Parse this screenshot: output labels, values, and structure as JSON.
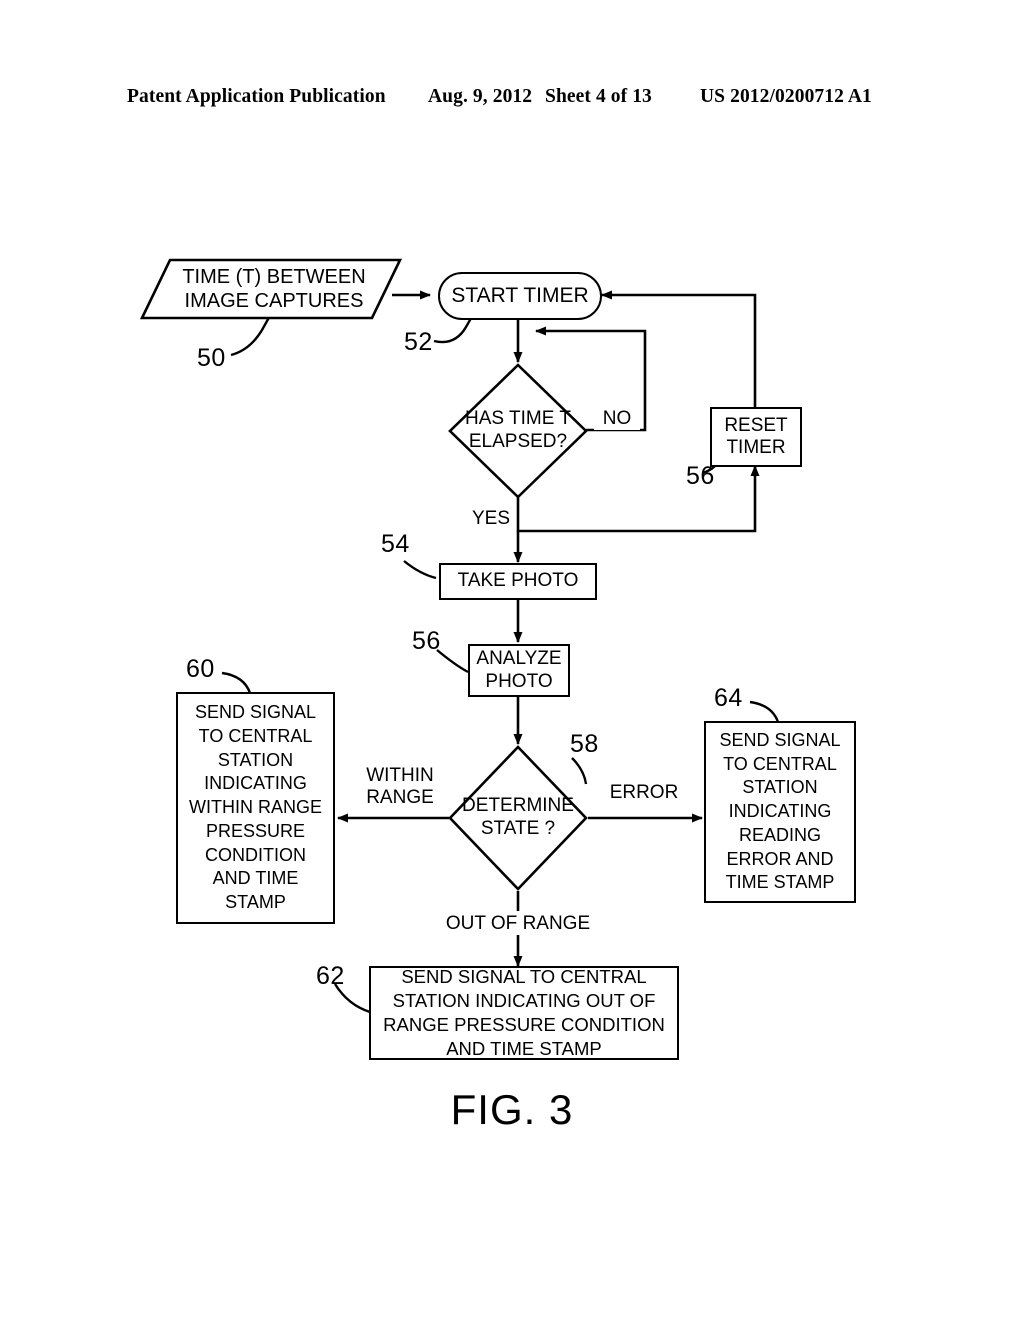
{
  "header": {
    "left": "Patent Application Publication",
    "date": "Aug. 9, 2012",
    "sheet": "Sheet 4 of 13",
    "number": "US 2012/0200712 A1"
  },
  "figure": {
    "caption": "FIG. 3",
    "type": "flowchart",
    "nodes": {
      "input_time": {
        "ref": "50",
        "shape": "parallelogram",
        "text": "TIME (T) BETWEEN\nIMAGE CAPTURES"
      },
      "start_timer": {
        "ref": "52",
        "shape": "terminator",
        "text": "START TIMER"
      },
      "has_time_elapsed": {
        "shape": "diamond",
        "text": "HAS TIME T\nELAPSED?"
      },
      "reset_timer": {
        "ref": "56",
        "shape": "process",
        "text": "RESET\nTIMER"
      },
      "take_photo": {
        "ref": "54",
        "shape": "process",
        "text": "TAKE PHOTO"
      },
      "analyze_photo": {
        "ref": "56",
        "shape": "process",
        "text": "ANALYZE\nPHOTO"
      },
      "determine_state": {
        "ref": "58",
        "shape": "diamond",
        "text": "DETERMINE\nSTATE ?"
      },
      "within_range_action": {
        "ref": "60",
        "shape": "process",
        "text": "SEND SIGNAL\nTO CENTRAL\nSTATION\nINDICATING\nWITHIN RANGE\nPRESSURE\nCONDITION\nAND TIME\nSTAMP"
      },
      "out_of_range_action": {
        "ref": "62",
        "shape": "process",
        "text": "SEND SIGNAL TO CENTRAL\nSTATION INDICATING OUT OF\nRANGE PRESSURE CONDITION\nAND TIME STAMP"
      },
      "error_action": {
        "ref": "64",
        "shape": "process",
        "text": "SEND SIGNAL\nTO CENTRAL\nSTATION\nINDICATING\nREADING\nERROR AND\nTIME STAMP"
      }
    },
    "edge_labels": {
      "no": "NO",
      "yes": "YES",
      "within_range": "WITHIN\nRANGE",
      "error": "ERROR",
      "out_of_range": "OUT OF RANGE"
    }
  },
  "colors": {
    "ink": "#000000",
    "paper": "#ffffff"
  }
}
